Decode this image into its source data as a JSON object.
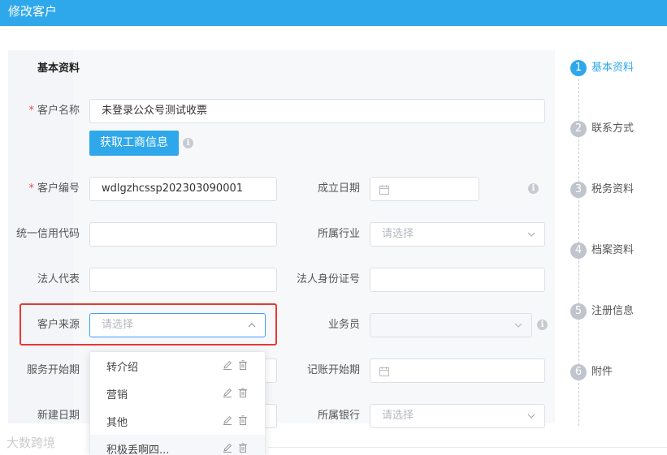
{
  "window": {
    "title": "修改客户"
  },
  "section": {
    "title": "基本资料"
  },
  "form": {
    "customer_name": {
      "label": "客户名称",
      "value": "未登录公众号测试收票"
    },
    "fetch_button": "获取工商信息",
    "customer_code": {
      "label": "客户编号",
      "value": "wdlgzhcssp202303090001"
    },
    "establish_date": {
      "label": "成立日期"
    },
    "credit_code": {
      "label": "统一信用代码"
    },
    "industry": {
      "label": "所属行业",
      "placeholder": "请选择"
    },
    "legal_rep": {
      "label": "法人代表"
    },
    "legal_id": {
      "label": "法人身份证号"
    },
    "source": {
      "label": "客户来源",
      "placeholder": "请选择"
    },
    "salesman": {
      "label": "业务员"
    },
    "service_start": {
      "label": "服务开始期"
    },
    "accounting_start": {
      "label": "记账开始期"
    },
    "create_date": {
      "label": "新建日期"
    },
    "bank": {
      "label": "所属银行",
      "placeholder": "请选择"
    }
  },
  "source_dropdown": {
    "options": [
      "转介绍",
      "营销",
      "其他",
      "积极丢啊四..."
    ]
  },
  "steps": [
    {
      "num": "1",
      "label": "基本资料",
      "active": true
    },
    {
      "num": "2",
      "label": "联系方式"
    },
    {
      "num": "3",
      "label": "税务资料"
    },
    {
      "num": "4",
      "label": "档案资料"
    },
    {
      "num": "5",
      "label": "注册信息"
    },
    {
      "num": "6",
      "label": "附件"
    }
  ],
  "watermark": "大数跨境",
  "colors": {
    "primary": "#2ea8ea",
    "required": "#f04b4b",
    "highlight": "#e53935"
  },
  "icons": [
    "info-icon",
    "chevron-down-icon",
    "chevron-up-icon",
    "calendar-icon",
    "edit-icon",
    "delete-icon"
  ]
}
